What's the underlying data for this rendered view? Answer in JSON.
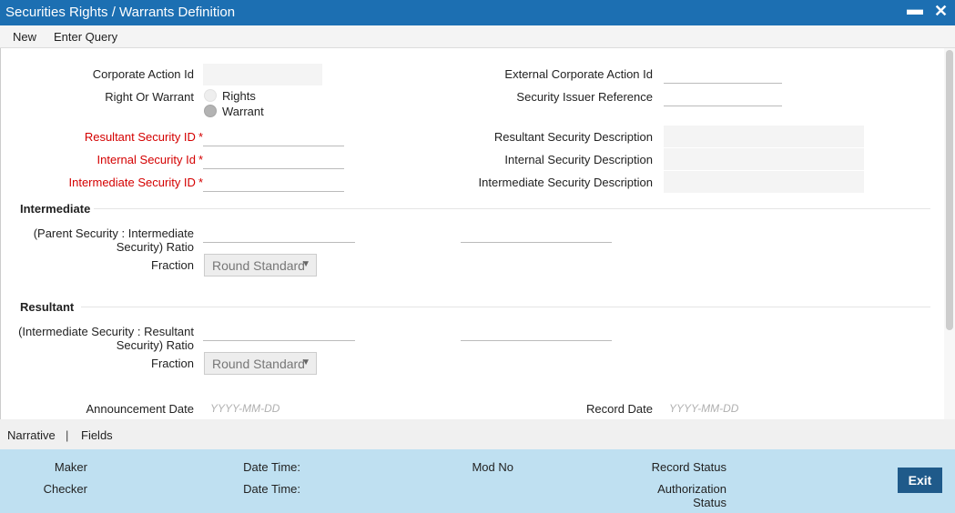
{
  "window": {
    "title": "Securities Rights / Warrants Definition",
    "minimize_glyph": "▬",
    "close_glyph": "✕"
  },
  "menu": {
    "new": "New",
    "enter_query": "Enter Query"
  },
  "form": {
    "corporate_action_id": {
      "label": "Corporate Action Id",
      "value": ""
    },
    "external_corporate_action_id": {
      "label": "External Corporate Action Id",
      "value": ""
    },
    "right_or_warrant": {
      "label": "Right Or Warrant",
      "options": [
        "Rights",
        "Warrant"
      ],
      "selected": "Warrant"
    },
    "security_issuer_reference": {
      "label": "Security Issuer Reference",
      "value": ""
    },
    "resultant_security_id": {
      "label": "Resultant Security ID",
      "value": "",
      "required_mark": "*"
    },
    "resultant_security_description": {
      "label": "Resultant Security Description",
      "value": ""
    },
    "internal_security_id": {
      "label": "Internal Security Id",
      "value": "",
      "required_mark": "*"
    },
    "internal_security_description": {
      "label": "Internal Security Description",
      "value": ""
    },
    "intermediate_security_id": {
      "label": "Intermediate Security ID",
      "value": "",
      "required_mark": "*"
    },
    "intermediate_security_description": {
      "label": "Intermediate Security Description",
      "value": ""
    }
  },
  "intermediate": {
    "title": "Intermediate",
    "ratio_label_line1": "(Parent Security : Intermediate",
    "ratio_label_line2": "Security) Ratio",
    "fraction_label": "Fraction",
    "fraction_value": "Round Standard"
  },
  "resultant": {
    "title": "Resultant",
    "ratio_label_line1": "(Intermediate Security : Resultant",
    "ratio_label_line2": "Security) Ratio",
    "fraction_label": "Fraction",
    "fraction_value": "Round Standard"
  },
  "dates": {
    "announcement_label": "Announcement Date",
    "announcement_placeholder": "YYYY-MM-DD",
    "record_label": "Record Date",
    "record_placeholder": "YYYY-MM-DD"
  },
  "tabs": {
    "narrative": "Narrative",
    "separator": "|",
    "fields": "Fields"
  },
  "footer": {
    "maker": "Maker",
    "checker": "Checker",
    "date_time_1": "Date Time:",
    "date_time_2": "Date Time:",
    "mod_no": "Mod No",
    "record_status": "Record Status",
    "authorization_status_line1": "Authorization",
    "authorization_status_line2": "Status",
    "exit": "Exit"
  },
  "colors": {
    "titlebar": "#1c6fb2",
    "required": "#d40000",
    "footer": "#bfe0f1",
    "exit_button": "#1f5a8a"
  }
}
